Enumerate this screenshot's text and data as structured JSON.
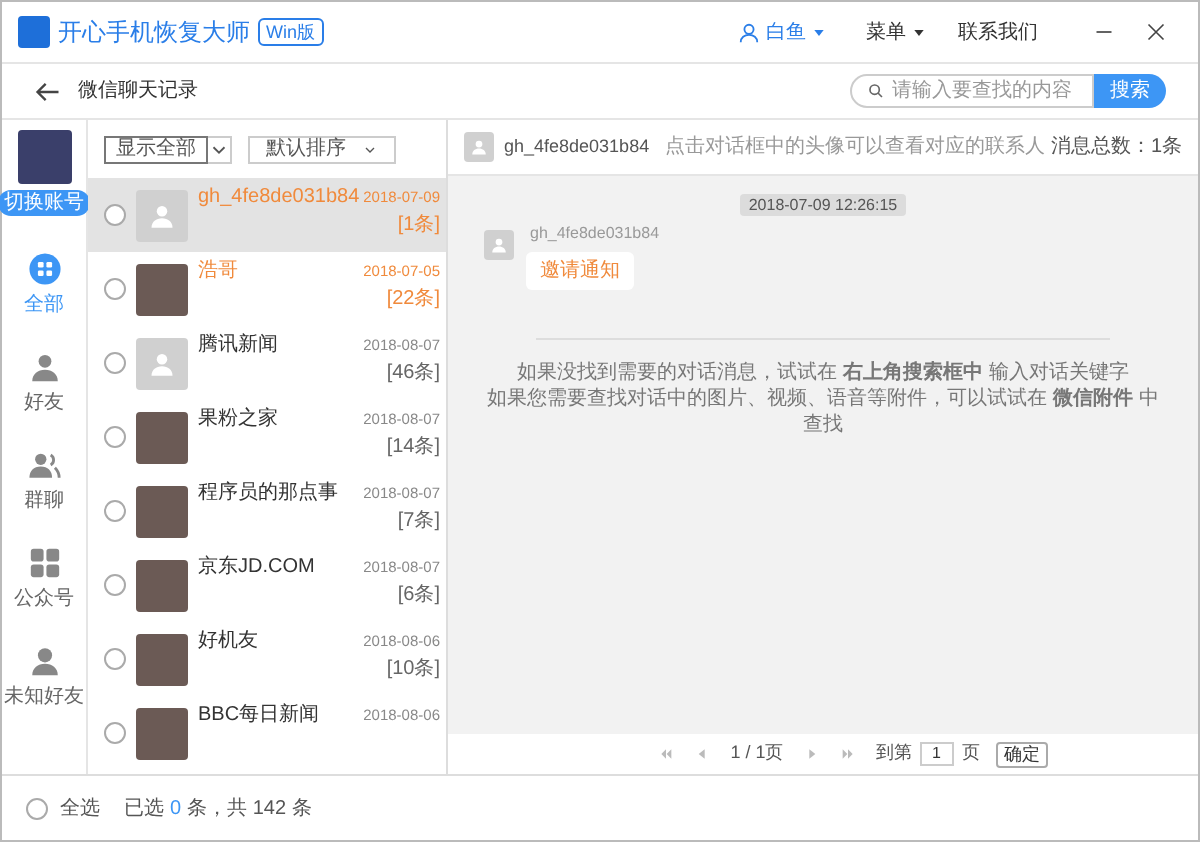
{
  "app": {
    "title": "开心手机恢复大师",
    "edition": "Win版",
    "user": "白鱼",
    "menu": "菜单",
    "contact": "联系我们"
  },
  "toolbar": {
    "title": "微信聊天记录",
    "search": {
      "placeholder": "请输入要查找的内容"
    },
    "search_button": "搜索"
  },
  "account": {
    "switch_button": "切换账号"
  },
  "nav": [
    {
      "kind": "all",
      "label": "全部",
      "selected": true
    },
    {
      "kind": "friend",
      "label": "好友",
      "selected": false
    },
    {
      "kind": "group",
      "label": "群聊",
      "selected": false
    },
    {
      "kind": "official",
      "label": "公众号",
      "selected": false
    },
    {
      "kind": "unknown",
      "label": "未知好友",
      "selected": false
    }
  ],
  "filters": {
    "show": "显示全部",
    "sort": "默认排序"
  },
  "chats": [
    {
      "kind": "placeholder",
      "name": "gh_4fe8de031b84",
      "date": "2018-07-09",
      "count": "[1条]",
      "selected": true,
      "highlighted": true,
      "checked": false
    },
    {
      "kind": "photo",
      "name": "浩哥",
      "date": "2018-07-05",
      "count": "[22条]",
      "selected": false,
      "highlighted": true,
      "checked": false
    },
    {
      "kind": "placeholder",
      "name": "腾讯新闻",
      "date": "2018-08-07",
      "count": "[46条]",
      "selected": false,
      "highlighted": false,
      "checked": false
    },
    {
      "kind": "photo",
      "name": "果粉之家",
      "date": "2018-08-07",
      "count": "[14条]",
      "selected": false,
      "highlighted": false,
      "checked": false
    },
    {
      "kind": "photo",
      "name": "程序员的那点事",
      "date": "2018-08-07",
      "count": "[7条]",
      "selected": false,
      "highlighted": false,
      "checked": false
    },
    {
      "kind": "photo",
      "name": "京东JD.COM",
      "date": "2018-08-07",
      "count": "[6条]",
      "selected": false,
      "highlighted": false,
      "checked": false
    },
    {
      "kind": "photo",
      "name": "好机友",
      "date": "2018-08-06",
      "count": "[10条]",
      "selected": false,
      "highlighted": false,
      "checked": false
    },
    {
      "kind": "photo",
      "name": "BBC每日新闻",
      "date": "2018-08-06",
      "selected": false,
      "highlighted": false,
      "checked": false
    }
  ],
  "conversation": {
    "name": "gh_4fe8de031b84",
    "hint": "点击对话框中的头像可以查看对应的联系人",
    "total": "消息总数：1条",
    "timestamp": "2018-07-09 12:26:15",
    "messages": [
      {
        "sender": "gh_4fe8de031b84",
        "text": "邀请通知"
      }
    ],
    "tips": [
      "如果没找到需要的对话消息，试试在 **右上角搜索框中** 输入对话关键字",
      "如果您需要查找对话中的图片、视频、语音等附件，可以试试在 **微信附件** 中查找"
    ]
  },
  "pagination": {
    "page": "1 / 1页",
    "goto_label": "到第",
    "goto_value": "1",
    "page_unit": "页",
    "confirm": "确定"
  },
  "footer": {
    "select_all": "全选",
    "selected_prefix": "已选",
    "selected_count": "0",
    "selected_suffix": "条，共 142 条",
    "select_all_checked": false
  }
}
